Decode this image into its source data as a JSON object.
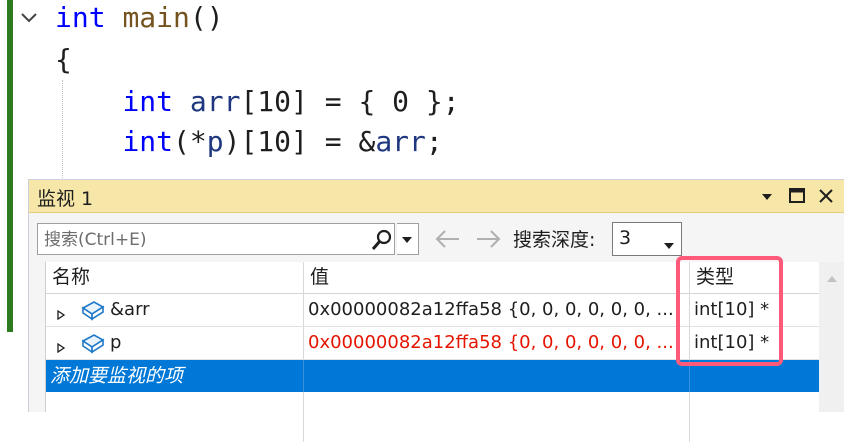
{
  "editor": {
    "lines": [
      [
        {
          "t": "int",
          "c": "kw"
        },
        {
          "t": " ",
          "c": "punc"
        },
        {
          "t": "main",
          "c": "fn"
        },
        {
          "t": "()",
          "c": "punc"
        }
      ],
      [
        {
          "t": "{",
          "c": "punc"
        }
      ],
      [
        {
          "t": "    ",
          "c": "punc"
        },
        {
          "t": "int",
          "c": "kw"
        },
        {
          "t": " ",
          "c": "punc"
        },
        {
          "t": "arr",
          "c": "var"
        },
        {
          "t": "[10] = { 0 };",
          "c": "punc"
        }
      ],
      [
        {
          "t": "    ",
          "c": "punc"
        },
        {
          "t": "int",
          "c": "kw"
        },
        {
          "t": "(*",
          "c": "punc"
        },
        {
          "t": "p",
          "c": "var"
        },
        {
          "t": ")[10] = &",
          "c": "punc"
        },
        {
          "t": "arr",
          "c": "var"
        },
        {
          "t": ";",
          "c": "punc"
        }
      ]
    ]
  },
  "watch": {
    "title": "监视 1",
    "search": {
      "placeholder": "搜索(Ctrl+E)",
      "value": ""
    },
    "depth_label": "搜索深度:",
    "depth_value": "3",
    "columns": [
      "名称",
      "值",
      "类型"
    ],
    "rows": [
      {
        "name": "&arr",
        "value": "0x00000082a12ffa58 {0, 0, 0, 0, 0, 0, ...",
        "type": "int[10] *",
        "changed": false
      },
      {
        "name": "p",
        "value": "0x00000082a12ffa58 {0, 0, 0, 0, 0, 0, ...",
        "type": "int[10] *",
        "changed": true
      }
    ],
    "add_item": "添加要监视的项"
  },
  "colors": {
    "keyword": "#0000ff",
    "changed_value": "#e51400",
    "selection": "#0078d7",
    "titlebar": "#f6e7a8",
    "highlight_box": "#ff5a7a"
  }
}
